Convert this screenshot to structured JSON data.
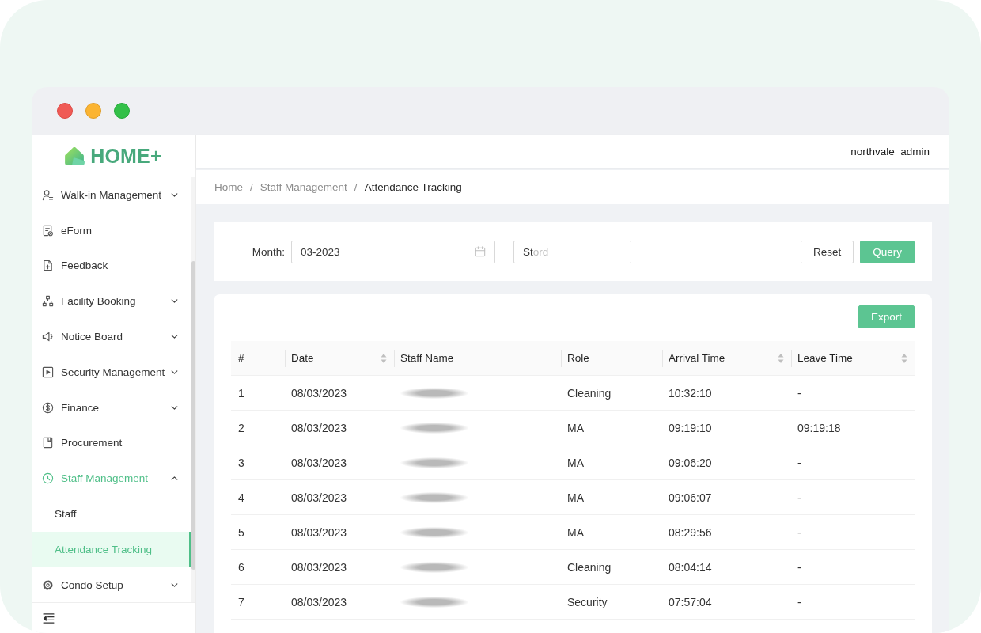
{
  "window": {
    "controls": [
      {
        "kind": "close"
      },
      {
        "kind": "minimize"
      },
      {
        "kind": "zoom"
      }
    ]
  },
  "sidebar": {
    "brand": "HOME+",
    "items": [
      {
        "kind": "group",
        "label": "Walk-in Management",
        "expanded": false,
        "selected": false
      },
      {
        "kind": "link",
        "label": "eForm",
        "selected": false
      },
      {
        "kind": "link",
        "label": "Feedback",
        "selected": false
      },
      {
        "kind": "group",
        "label": "Facility Booking",
        "expanded": false,
        "selected": false
      },
      {
        "kind": "group",
        "label": "Notice Board",
        "expanded": false,
        "selected": false
      },
      {
        "kind": "group",
        "label": "Security Management",
        "expanded": false,
        "selected": false
      },
      {
        "kind": "group",
        "label": "Finance",
        "expanded": false,
        "selected": false
      },
      {
        "kind": "link",
        "label": "Procurement",
        "selected": false
      },
      {
        "kind": "group",
        "label": "Staff Management",
        "expanded": true,
        "selected": true,
        "children": [
          {
            "label": "Staff",
            "selected": false
          },
          {
            "label": "Attendance Tracking",
            "selected": true
          }
        ]
      },
      {
        "kind": "group",
        "label": "Condo Setup",
        "expanded": false,
        "selected": false
      }
    ]
  },
  "topbar": {
    "username": "northvale_admin"
  },
  "breadcrumb": {
    "items": [
      {
        "label": "Home",
        "current": false
      },
      {
        "label": "Staff Management",
        "current": false
      },
      {
        "label": "Attendance Tracking",
        "current": true
      }
    ],
    "separators": [
      "/",
      "/"
    ]
  },
  "filter": {
    "month": {
      "label": "Month:",
      "value": "03-2023"
    },
    "keyword": {
      "value": "St",
      "placeholder": "ord"
    },
    "buttons": [
      {
        "label": "Reset",
        "kind": "default"
      },
      {
        "label": "Query",
        "kind": "primary"
      }
    ]
  },
  "table": {
    "toolbar": [
      {
        "label": "Export",
        "kind": "primary"
      }
    ],
    "columns": [
      {
        "label": "#",
        "sortable": false
      },
      {
        "label": "Date",
        "sortable": true
      },
      {
        "label": "Staff Name",
        "sortable": false
      },
      {
        "label": "Role",
        "sortable": false
      },
      {
        "label": "Arrival Time",
        "sortable": true
      },
      {
        "label": "Leave Time",
        "sortable": true
      }
    ],
    "rows": [
      {
        "index": "1",
        "date": "08/03/2023",
        "staff_name_blurred": true,
        "role": "Cleaning",
        "arrival_time": "10:32:10",
        "leave_time": "-"
      },
      {
        "index": "2",
        "date": "08/03/2023",
        "staff_name_blurred": true,
        "role": "MA",
        "arrival_time": "09:19:10",
        "leave_time": "09:19:18"
      },
      {
        "index": "3",
        "date": "08/03/2023",
        "staff_name_blurred": true,
        "role": "MA",
        "arrival_time": "09:06:20",
        "leave_time": "-"
      },
      {
        "index": "4",
        "date": "08/03/2023",
        "staff_name_blurred": true,
        "role": "MA",
        "arrival_time": "09:06:07",
        "leave_time": "-"
      },
      {
        "index": "5",
        "date": "08/03/2023",
        "staff_name_blurred": true,
        "role": "MA",
        "arrival_time": "08:29:56",
        "leave_time": "-"
      },
      {
        "index": "6",
        "date": "08/03/2023",
        "staff_name_blurred": true,
        "role": "Cleaning",
        "arrival_time": "08:04:14",
        "leave_time": "-"
      },
      {
        "index": "7",
        "date": "08/03/2023",
        "staff_name_blurred": true,
        "role": "Security",
        "arrival_time": "07:57:04",
        "leave_time": "-"
      }
    ]
  }
}
